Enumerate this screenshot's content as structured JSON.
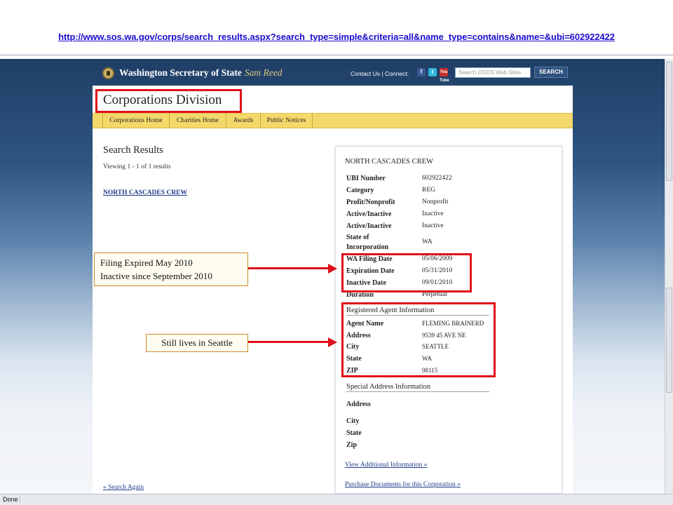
{
  "browser": {
    "url": "http://www.sos.wa.gov/corps/search_results.aspx?search_type=simple&criteria=all&name_type=contains&name=&ubi=602922422",
    "status": "Done"
  },
  "header": {
    "title": "Washington Secretary of State",
    "signature": "Sam Reed",
    "contact": "Contact Us | Connect:",
    "social": {
      "facebook": "f",
      "twitter": "t",
      "youtube": "You Tube"
    },
    "search_placeholder": "Search OSOS Web Sites",
    "search_button": "SEARCH"
  },
  "division_title": "Corporations Division",
  "nav": [
    "Corporations Home",
    "Charities Home",
    "Awards",
    "Public Notices"
  ],
  "results": {
    "title": "Search Results",
    "viewing": "Viewing 1 - 1 of 1 results",
    "link": "NORTH CASCADES CREW",
    "search_again": "« Search Again"
  },
  "detail": {
    "name": "NORTH CASCADES CREW",
    "fields": [
      {
        "label": "UBI Number",
        "value": "602922422"
      },
      {
        "label": "Category",
        "value": "REG"
      },
      {
        "label": "Profit/Nonprofit",
        "value": "Nonprofit"
      },
      {
        "label": "Active/Inactive",
        "value": "Inactive"
      },
      {
        "label": "Active/Inactive",
        "value": "Inactive"
      },
      {
        "label": "State of",
        "label2": "Incorporation",
        "value": "WA"
      },
      {
        "label": "WA Filing Date",
        "value": "05/06/2009"
      },
      {
        "label": "Expiration Date",
        "value": "05/31/2010"
      },
      {
        "label": "Inactive Date",
        "value": "09/01/2010"
      },
      {
        "label": "Duration",
        "value": "Perpetual"
      }
    ],
    "agent_heading": "Registered Agent Information",
    "agent": [
      {
        "label": "Agent Name",
        "value": "FLEMING BRAINERD"
      },
      {
        "label": "Address",
        "value": "9539 45 AVE NE"
      },
      {
        "label": "City",
        "value": "SEATTLE"
      },
      {
        "label": "State",
        "value": "WA"
      },
      {
        "label": "ZIP",
        "value": "98115"
      }
    ],
    "special_heading": "Special Address Information",
    "special": [
      "Address",
      "City",
      "State",
      "Zip"
    ],
    "more_info": "View Additional Information »",
    "purchase": "Purchase Documents for this Corporation »"
  },
  "annotations": {
    "note1_line1": "Filing Expired May 2010",
    "note1_line2": "Inactive since September 2010",
    "note2": "Still lives in Seattle",
    "highlight_color": "#e0101a"
  }
}
